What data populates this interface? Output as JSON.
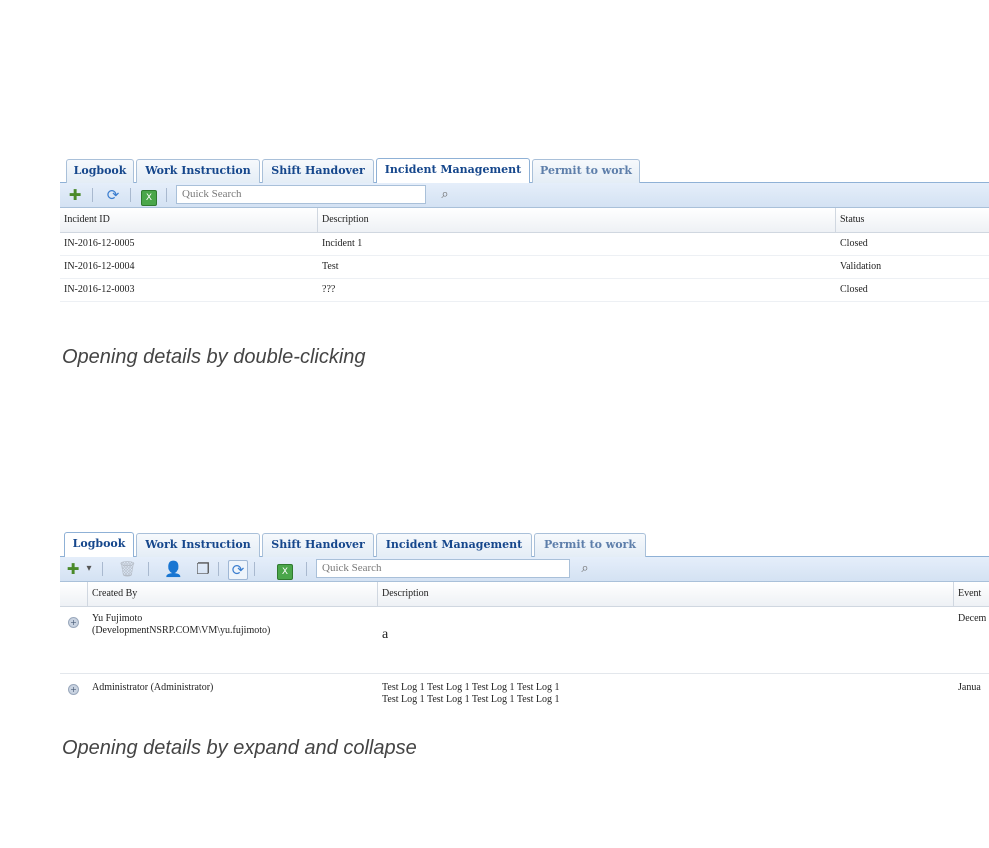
{
  "screenshot1": {
    "tabs": [
      "Logbook",
      "Work Instruction",
      "Shift Handover",
      "Incident Management",
      "Permit to work"
    ],
    "active_tab": "Incident Management",
    "search_placeholder": "Quick Search",
    "columns": [
      "Incident ID",
      "Description",
      "Status"
    ],
    "rows": [
      {
        "id": "IN-2016-12-0005",
        "description": "Incident 1",
        "status": "Closed"
      },
      {
        "id": "IN-2016-12-0004",
        "description": "Test",
        "status": "Validation"
      },
      {
        "id": "IN-2016-12-0003",
        "description": "???",
        "status": "Closed"
      }
    ]
  },
  "caption1": "Opening details by double-clicking",
  "screenshot2": {
    "tabs": [
      "Logbook",
      "Work Instruction",
      "Shift Handover",
      "Incident Management",
      "Permit to work"
    ],
    "active_tab": "Logbook",
    "search_placeholder": "Quick Search",
    "columns": [
      "Created By",
      "Description",
      "Event"
    ],
    "rows": [
      {
        "created_by_line1": "Yu Fujimoto",
        "created_by_line2": "(DevelopmentNSRP.COM\\VM\\yu.fujimoto)",
        "description_line1": "a",
        "description_line2": "",
        "event": "Decem"
      },
      {
        "created_by_line1": "Administrator (Administrator)",
        "created_by_line2": "",
        "description_line1": "Test Log 1 Test Log 1 Test Log 1 Test Log 1",
        "description_line2": "Test Log 1 Test Log 1 Test Log 1 Test Log 1",
        "event": "Janua"
      }
    ]
  },
  "caption2": "Opening details by expand and collapse",
  "icons": {
    "add": "plus-icon",
    "refresh": "refresh-icon",
    "export": "excel-export-icon",
    "search": "search-button-icon",
    "delete": "trash-icon",
    "user": "user-icon",
    "copy": "copy-icon",
    "expand": "expand-row-icon"
  },
  "colors": {
    "tab_text": "#16478c",
    "toolbar_bg": "#dbe7f5",
    "border": "#8fb1d6",
    "caption": "#444444"
  }
}
